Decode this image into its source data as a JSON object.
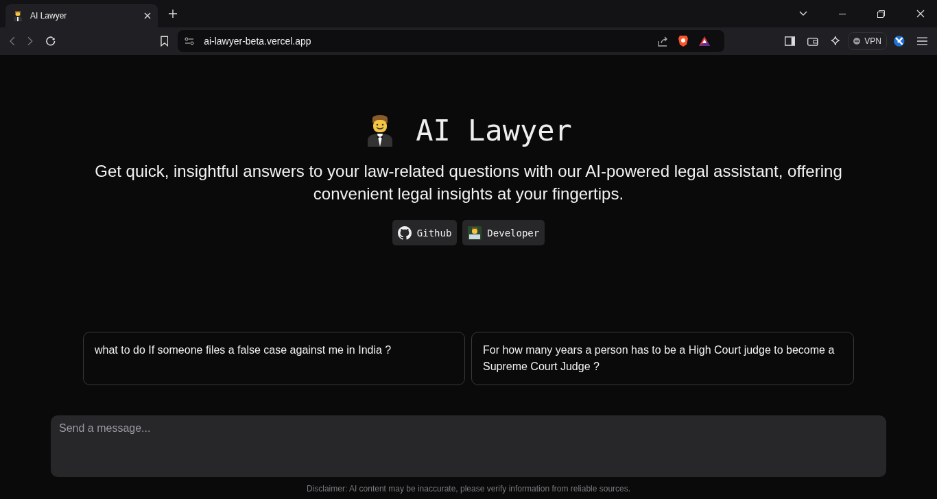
{
  "browser": {
    "tab": {
      "title": "AI Lawyer",
      "selected": true
    },
    "address": "ai-lawyer-beta.vercel.app",
    "vpn_label": "VPN"
  },
  "page": {
    "title": "AI Lawyer",
    "description": "Get quick, insightful answers to your law-related questions with our AI-powered legal assistant, offering convenient legal insights at your fingertips.",
    "links": [
      {
        "kind": "github",
        "label": "Github"
      },
      {
        "kind": "developer",
        "label": "Developer"
      }
    ],
    "suggestions": [
      "what to do If someone files a false case against me in India ?",
      "For how many years a person has to be a High Court judge to become a Supreme Court Judge ?"
    ],
    "message_field": {
      "placeholder": "Send a message..."
    },
    "disclaimer": "Disclaimer: AI content may be inaccurate, please verify information from reliable sources."
  }
}
